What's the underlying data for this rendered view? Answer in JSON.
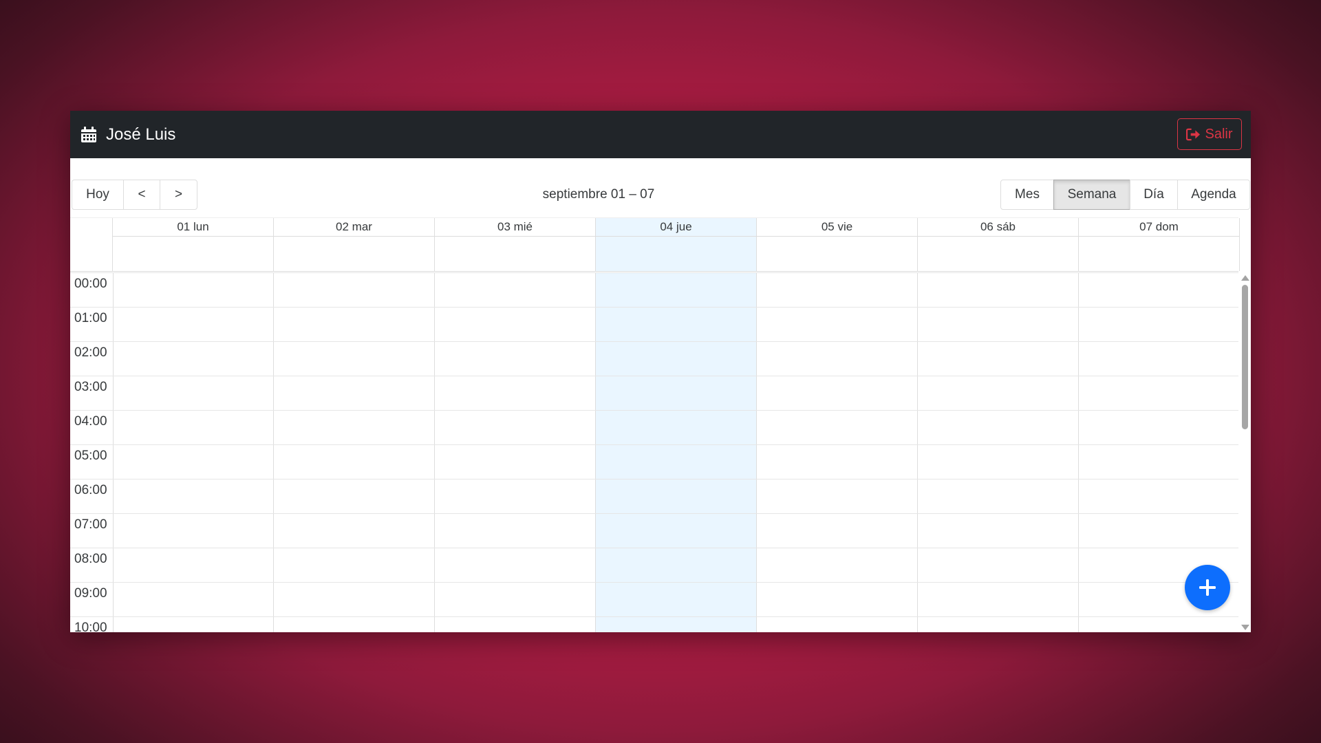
{
  "navbar": {
    "user_name": "José Luis",
    "logout_label": "Salir",
    "brand_icon": "calendar-icon",
    "logout_icon": "sign-out-icon",
    "logout_color": "#dc3545"
  },
  "toolbar": {
    "today_label": "Hoy",
    "prev_label": "<",
    "next_label": ">",
    "range_label": "septiembre 01 – 07",
    "views": [
      "Mes",
      "Semana",
      "Día",
      "Agenda"
    ],
    "active_view": "Semana"
  },
  "days": [
    {
      "label": "01 lun",
      "today": false
    },
    {
      "label": "02 mar",
      "today": false
    },
    {
      "label": "03 mié",
      "today": false
    },
    {
      "label": "04 jue",
      "today": true
    },
    {
      "label": "05 vie",
      "today": false
    },
    {
      "label": "06 sáb",
      "today": false
    },
    {
      "label": "07 dom",
      "today": false
    }
  ],
  "times": [
    "00:00",
    "01:00",
    "02:00",
    "03:00",
    "04:00",
    "05:00",
    "06:00",
    "07:00",
    "08:00",
    "09:00",
    "10:00"
  ],
  "fab_icon": "plus-icon",
  "colors": {
    "accent": "#0d6efd",
    "today_bg": "#eaf6ff",
    "navbar_bg": "#212529"
  }
}
